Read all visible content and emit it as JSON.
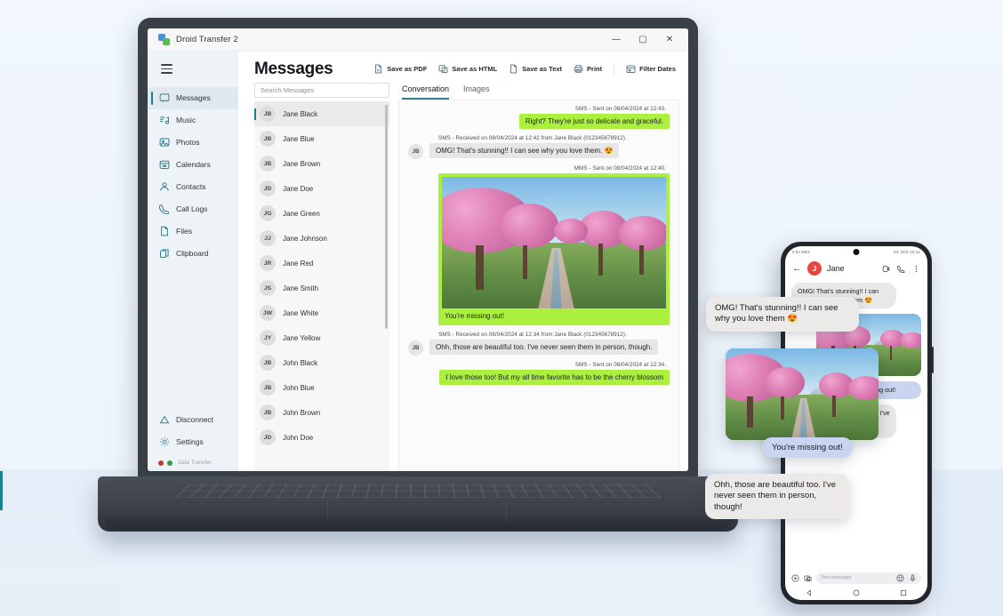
{
  "window": {
    "title": "Droid Transfer 2",
    "minimize": "—",
    "maximize": "▢",
    "close": "✕"
  },
  "sidebar": {
    "items": [
      {
        "label": "Messages",
        "icon": "message-icon",
        "active": true
      },
      {
        "label": "Music",
        "icon": "music-icon",
        "active": false
      },
      {
        "label": "Photos",
        "icon": "photos-icon",
        "active": false
      },
      {
        "label": "Calendars",
        "icon": "calendar-icon",
        "active": false
      },
      {
        "label": "Contacts",
        "icon": "contacts-icon",
        "active": false
      },
      {
        "label": "Call Logs",
        "icon": "phone-icon",
        "active": false
      },
      {
        "label": "Files",
        "icon": "file-icon",
        "active": false
      },
      {
        "label": "Clipboard",
        "icon": "clipboard-icon",
        "active": false
      }
    ],
    "bottom": [
      {
        "label": "Disconnect",
        "icon": "disconnect-icon"
      },
      {
        "label": "Settings",
        "icon": "gear-icon"
      }
    ],
    "status_label": "Data Transfer"
  },
  "header": {
    "title": "Messages",
    "toolbar": [
      {
        "label": "Save as PDF",
        "icon": "pdf-icon"
      },
      {
        "label": "Save as HTML",
        "icon": "html-icon"
      },
      {
        "label": "Save as Text",
        "icon": "text-icon"
      },
      {
        "label": "Print",
        "icon": "print-icon"
      },
      {
        "label": "Filter Dates",
        "icon": "calendar-filter-icon"
      }
    ]
  },
  "search": {
    "placeholder": "Search Messages",
    "value": ""
  },
  "contacts": [
    {
      "initials": "JB",
      "name": "Jane Black",
      "selected": true
    },
    {
      "initials": "JB",
      "name": "Jane Blue",
      "selected": false
    },
    {
      "initials": "JB",
      "name": "Jane Brown",
      "selected": false
    },
    {
      "initials": "JD",
      "name": "Jane Doe",
      "selected": false
    },
    {
      "initials": "JG",
      "name": "Jane Green",
      "selected": false
    },
    {
      "initials": "JJ",
      "name": "Jane Johnson",
      "selected": false
    },
    {
      "initials": "JR",
      "name": "Jane Red",
      "selected": false
    },
    {
      "initials": "JS",
      "name": "Jane Smith",
      "selected": false
    },
    {
      "initials": "JW",
      "name": "Jane White",
      "selected": false
    },
    {
      "initials": "JY",
      "name": "Jane Yellow",
      "selected": false
    },
    {
      "initials": "JB",
      "name": "John Black",
      "selected": false
    },
    {
      "initials": "JB",
      "name": "John Blue",
      "selected": false
    },
    {
      "initials": "JB",
      "name": "John Brown",
      "selected": false
    },
    {
      "initials": "JD",
      "name": "John Doe",
      "selected": false
    }
  ],
  "tabs": [
    {
      "label": "Conversation",
      "active": true
    },
    {
      "label": "Images",
      "active": false
    }
  ],
  "conversation": [
    {
      "dir": "out",
      "meta": "SMS - Sent on 08/04/2024 at 12:43.",
      "text": "Right? They're just so delicate and graceful."
    },
    {
      "dir": "in",
      "avatar": "JB",
      "meta": "SMS - Received on 08/04/2024 at 12:42 from Jane Black (012345678912).",
      "text": "OMG! That's stunning!! I can see why you love them. 😍"
    },
    {
      "dir": "out",
      "type": "mms",
      "meta": "MMS - Sent on 08/04/2024 at 12:40.",
      "caption": "You're missing out!",
      "image_alt": "cherry-blossom-avenue-photo"
    },
    {
      "dir": "in",
      "avatar": "JB",
      "meta": "SMS - Received on 08/04/2024 at 12:34 from Jane Black (012345678912).",
      "text": "Ohh, those are beautiful too. I've never seen them in person, though."
    },
    {
      "dir": "out",
      "meta": "SMS - Sent on 08/04/2024 at 12:34.",
      "text": "I love those too! But my all time favorite has to be the cherry blossom"
    }
  ],
  "phone": {
    "status_left": "0.01 KB/s",
    "status_right": "4G 24% 10:11",
    "contact_initial": "J",
    "contact_name": "Jane",
    "actions": [
      "video-call-icon",
      "phone-call-icon",
      "overflow-menu-icon"
    ],
    "thread": [
      {
        "dir": "in",
        "text": "OMG! That's stunning!! I can see why you love them 😍"
      },
      {
        "dir": "out",
        "type": "image",
        "image_alt": "cherry-blossom-avenue-photo"
      },
      {
        "dir": "out",
        "text": "You're missing out!"
      },
      {
        "dir": "in",
        "text": "Ohh, those are beautiful too. I've never seen them in person, though!"
      }
    ],
    "input_placeholder": "Text message",
    "nav": [
      "back-triangle-icon",
      "home-circle-icon",
      "recents-square-icon"
    ]
  },
  "overlay": {
    "bubble_in_1": "OMG! That's stunning!! I can see why you love them 😍",
    "bubble_out_1": "You're missing out!",
    "bubble_in_2": "Ohh, those are beautiful too. I've never seen them in person, though!"
  }
}
